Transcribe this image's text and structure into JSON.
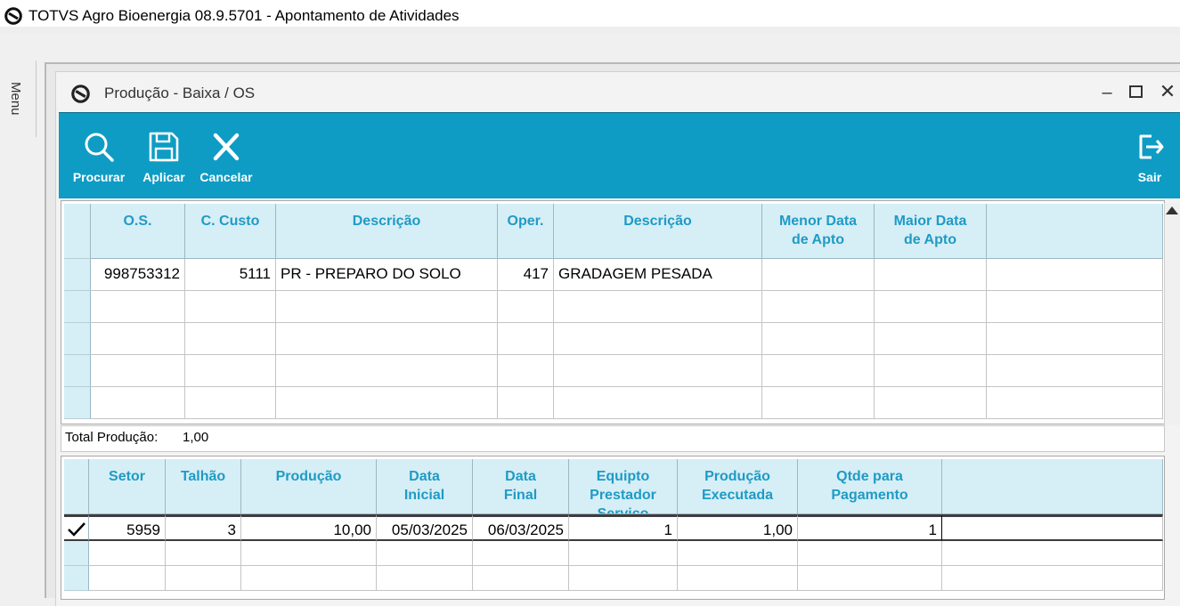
{
  "app": {
    "title": "TOTVS Agro Bioenergia 08.9.5701 - Apontamento de Atividades"
  },
  "menu": {
    "label": "Menu"
  },
  "window": {
    "title": "Produção - Baixa / OS",
    "minimize": "–",
    "close": "✕"
  },
  "toolbar": {
    "search_label": "Procurar",
    "apply_label": "Aplicar",
    "cancel_label": "Cancelar",
    "exit_label": "Sair",
    "accent_color": "#0e9cc4"
  },
  "os_grid": {
    "headers": {
      "os": "O.S.",
      "c_custo": "C. Custo",
      "descricao": "Descrição",
      "oper": "Oper.",
      "descricao2": "Descrição",
      "menor_data_1": "Menor Data",
      "menor_data_2": "de Apto",
      "maior_data_1": "Maior Data",
      "maior_data_2": "de Apto"
    },
    "rows": [
      {
        "os": "998753312",
        "c_custo": "5111",
        "descricao": "PR - PREPARO DO SOLO",
        "oper": "417",
        "descricao2": "GRADAGEM PESADA",
        "menor_data": "",
        "maior_data": ""
      }
    ]
  },
  "totals": {
    "label": "Total Produção:",
    "value": "1,00"
  },
  "prod_grid": {
    "headers": {
      "setor": "Setor",
      "talhao": "Talhão",
      "producao": "Produção",
      "data_inicial_1": "Data",
      "data_inicial_2": "Inicial",
      "data_final_1": "Data",
      "data_final_2": "Final",
      "equipto_1": "Equipto",
      "equipto_2": "Prestador",
      "equipto_3": "Serviço",
      "prod_exec_1": "Produção",
      "prod_exec_2": "Executada",
      "qtde_1": "Qtde para",
      "qtde_2": "Pagamento"
    },
    "rows": [
      {
        "setor": "5959",
        "talhao": "3",
        "producao": "10,00",
        "data_inicial": "05/03/2025",
        "data_final": "06/03/2025",
        "equipto": "1",
        "producao_executada": "1,00",
        "qtde_pagamento": "1"
      }
    ]
  }
}
